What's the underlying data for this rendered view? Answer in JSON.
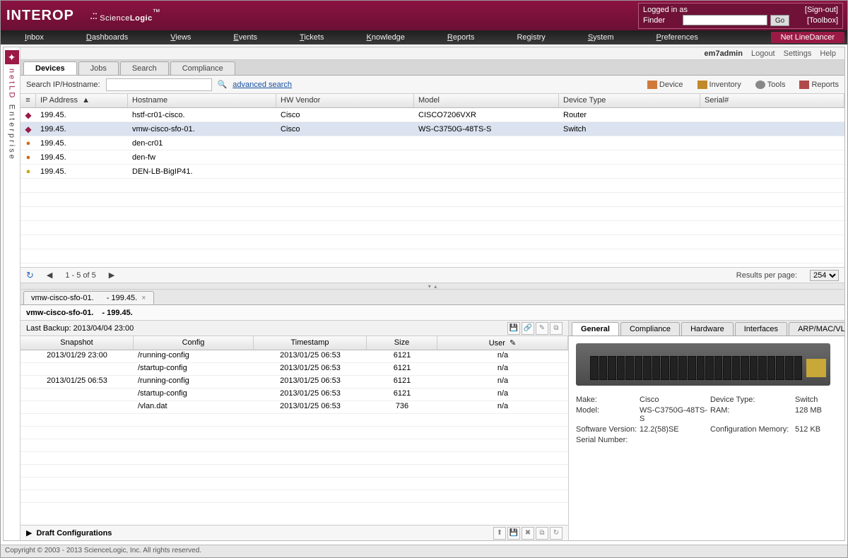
{
  "header": {
    "logo1": "INTEROP",
    "logo2_pre": ".::",
    "logo2": "Science",
    "logo2b": "Logic",
    "tm": "™",
    "login": {
      "logged_in_as": "Logged in as",
      "signout": "[Sign-out]",
      "finder": "Finder",
      "go": "Go",
      "toolbox": "[Toolbox]"
    }
  },
  "menu": [
    "Inbox",
    "Dashboards",
    "Views",
    "Events",
    "Tickets",
    "Knowledge",
    "Reports",
    "Registry",
    "System",
    "Preferences"
  ],
  "menu_active": "Net LineDancer",
  "sidebar": {
    "text1": "netLD",
    "text2": "Enterprise"
  },
  "acct": {
    "user": "em7admin",
    "logout": "Logout",
    "settings": "Settings",
    "help": "Help"
  },
  "tabs": [
    "Devices",
    "Jobs",
    "Search",
    "Compliance"
  ],
  "search": {
    "label": "Search IP/Hostname:",
    "adv": "advanced search",
    "rbtns": [
      "Device",
      "Inventory",
      "Tools",
      "Reports"
    ]
  },
  "grid": {
    "cols": [
      "IP Address",
      "Hostname",
      "HW Vendor",
      "Model",
      "Device Type",
      "Serial#"
    ],
    "rows": [
      {
        "ic": "shield",
        "ip": "199.45.",
        "host": "hstf-cr01-cisco.",
        "ven": "Cisco",
        "mod": "CISCO7206VXR",
        "dt": "Router",
        "sn": ""
      },
      {
        "ic": "shield",
        "ip": "199.45.",
        "host": "vmw-cisco-sfo-01.",
        "ven": "Cisco",
        "mod": "WS-C3750G-48TS-S",
        "dt": "Switch",
        "sn": "",
        "sel": true
      },
      {
        "ic": "warn",
        "ip": "199.45.",
        "host": "den-cr01",
        "ven": "",
        "mod": "",
        "dt": "",
        "sn": ""
      },
      {
        "ic": "warn",
        "ip": "199.45.",
        "host": "den-fw",
        "ven": "",
        "mod": "",
        "dt": "",
        "sn": ""
      },
      {
        "ic": "ok",
        "ip": "199.45.",
        "host": "DEN-LB-BigIP41.",
        "ven": "",
        "mod": "",
        "dt": "",
        "sn": ""
      }
    ]
  },
  "pager": {
    "range": "1 - 5 of 5",
    "rpp_label": "Results per page:",
    "rpp": "254"
  },
  "detail": {
    "tab_host": "vmw-cisco-sfo-01.",
    "tab_ip": "- 199.45.",
    "title_host": "vmw-cisco-sfo-01.",
    "title_ip": "- 199.45.",
    "last_backup": "Last Backup: 2013/04/04 23:00",
    "cfg_cols": [
      "Snapshot",
      "Config",
      "Timestamp",
      "Size",
      "User"
    ],
    "cfg_rows": [
      {
        "snap": "2013/01/29 23:00",
        "cfg": "/running-config",
        "ts": "2013/01/25 06:53",
        "sz": "6121",
        "usr": "n/a"
      },
      {
        "snap": "",
        "cfg": "/startup-config",
        "ts": "2013/01/25 06:53",
        "sz": "6121",
        "usr": "n/a"
      },
      {
        "snap": "2013/01/25 06:53",
        "cfg": "/running-config",
        "ts": "2013/01/25 06:53",
        "sz": "6121",
        "usr": "n/a"
      },
      {
        "snap": "",
        "cfg": "/startup-config",
        "ts": "2013/01/25 06:53",
        "sz": "6121",
        "usr": "n/a"
      },
      {
        "snap": "",
        "cfg": "/vlan.dat",
        "ts": "2013/01/25 06:53",
        "sz": "736",
        "usr": "n/a"
      }
    ],
    "draft": "Draft Configurations"
  },
  "rtabs": [
    "General",
    "Compliance",
    "Hardware",
    "Interfaces",
    "ARP/MAC/VLAN"
  ],
  "info": {
    "make_k": "Make:",
    "make_v": "Cisco",
    "model_k": "Model:",
    "model_v": "WS-C3750G-48TS-S",
    "sw_k": "Software Version:",
    "sw_v": "12.2(58)SE",
    "sn_k": "Serial Number:",
    "sn_v": "",
    "dt_k": "Device Type:",
    "dt_v": "Switch",
    "ram_k": "RAM:",
    "ram_v": "128 MB",
    "cm_k": "Configuration Memory:",
    "cm_v": "512 KB"
  },
  "footer": "Copyright © 2003 - 2013 ScienceLogic, Inc. All rights reserved."
}
